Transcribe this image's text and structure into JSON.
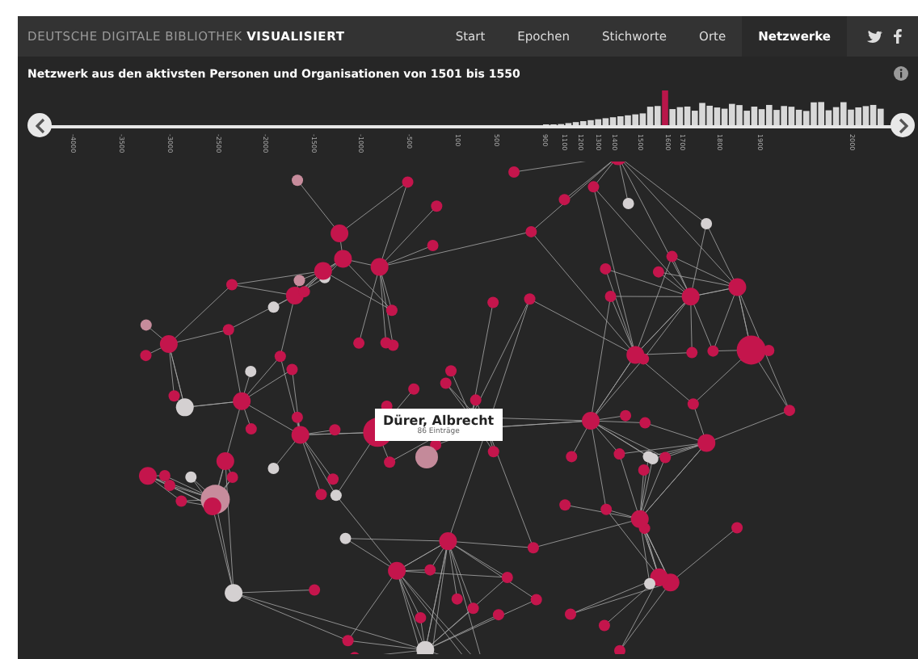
{
  "header": {
    "brand_light": "DEUTSCHE DIGITALE BIBLIOTHEK",
    "brand_bold": "VISUALISIERT"
  },
  "nav": [
    {
      "label": "Start",
      "selected": false
    },
    {
      "label": "Epochen",
      "selected": false
    },
    {
      "label": "Stichworte",
      "selected": false
    },
    {
      "label": "Orte",
      "selected": false
    },
    {
      "label": "Netzwerke",
      "selected": true
    }
  ],
  "heading": "Netzwerk aus den aktivsten Personen und Organisationen von 1501 bis 1550",
  "timeline": {
    "ticks": [
      "-4000",
      "-3500",
      "-3000",
      "-2500",
      "-2000",
      "-1500",
      "-1000",
      "-500",
      "100",
      "500",
      "900",
      "1100",
      "1200",
      "1300",
      "1400",
      "1500",
      "1600",
      "1700",
      "1800",
      "1900",
      "2000"
    ]
  },
  "tooltip": {
    "name": "Dürer, Albrecht",
    "count": "86 Einträge"
  }
}
